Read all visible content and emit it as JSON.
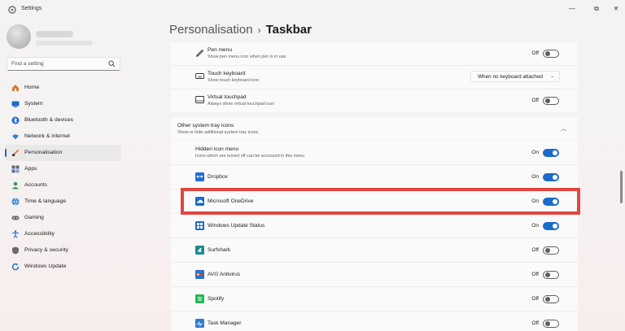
{
  "window": {
    "title": "Settings",
    "controls": [
      "—",
      "⧉",
      "✕"
    ]
  },
  "sidebar": {
    "search_placeholder": "Find a setting",
    "items": [
      {
        "label": "Home",
        "icon": "home-icon",
        "color": "#d47a3a"
      },
      {
        "label": "System",
        "icon": "system-icon",
        "color": "#1a6cc9"
      },
      {
        "label": "Bluetooth & devices",
        "icon": "bluetooth-icon",
        "color": "#1a6cc9"
      },
      {
        "label": "Network & internet",
        "icon": "wifi-icon",
        "color": "#2a86d6"
      },
      {
        "label": "Personalisation",
        "icon": "brush-icon",
        "color": "#d27a3a",
        "active": true
      },
      {
        "label": "Apps",
        "icon": "apps-icon",
        "color": "#5a6a8a"
      },
      {
        "label": "Accounts",
        "icon": "accounts-icon",
        "color": "#2e9b5a"
      },
      {
        "label": "Time & language",
        "icon": "globe-icon",
        "color": "#2a86d6"
      },
      {
        "label": "Gaming",
        "icon": "gamepad-icon",
        "color": "#6b6b6b"
      },
      {
        "label": "Accessibility",
        "icon": "accessibility-icon",
        "color": "#1a6cc9"
      },
      {
        "label": "Privacy & security",
        "icon": "shield-icon",
        "color": "#6b6b6b"
      },
      {
        "label": "Windows Update",
        "icon": "update-icon",
        "color": "#1a6cc9"
      }
    ]
  },
  "header": {
    "parent": "Personalisation",
    "separator": "›",
    "current": "Taskbar"
  },
  "top_rows": [
    {
      "title": "Pen menu",
      "sub": "Show pen menu icon when pen is in use",
      "icon": "pen-icon",
      "control": "toggle",
      "state": "Off"
    },
    {
      "title": "Touch keyboard",
      "sub": "Show touch keyboard icon",
      "icon": "keyboard-icon",
      "control": "dropdown",
      "value": "When no keyboard attached"
    },
    {
      "title": "Virtual touchpad",
      "sub": "Always show virtual touchpad icon",
      "icon": "touchpad-icon",
      "control": "toggle",
      "state": "Off"
    }
  ],
  "section": {
    "title": "Other system tray icons",
    "sub": "Show or hide additional system tray icons",
    "chevron": "^",
    "rows": [
      {
        "title": "Hidden icon menu",
        "sub": "Icons which are turned off can be accessed in this menu",
        "state": "On",
        "icon": ""
      },
      {
        "title": "Dropbox",
        "state": "On",
        "icon": "dropbox-icon",
        "color": "#1f6fd6"
      },
      {
        "title": "Microsoft OneDrive",
        "state": "On",
        "icon": "onedrive-icon",
        "color": "#1a6cc9",
        "highlighted": true
      },
      {
        "title": "Windows Update Status",
        "state": "On",
        "icon": "windows-update-status-icon",
        "color": "#1a6cc9"
      },
      {
        "title": "Surfshark",
        "state": "Off",
        "icon": "surfshark-icon",
        "color": "#1d8a8f"
      },
      {
        "title": "AVG Antivirus",
        "state": "Off",
        "icon": "avg-icon",
        "color": "#2f6fcf"
      },
      {
        "title": "Spotify",
        "state": "Off",
        "icon": "spotify-icon",
        "color": "#1db954"
      },
      {
        "title": "Task Manager",
        "state": "Off",
        "icon": "task-manager-icon",
        "color": "#2f7bd0"
      }
    ]
  },
  "colors": {
    "accent": "#1a6cc9",
    "highlight": "#e0473f"
  }
}
